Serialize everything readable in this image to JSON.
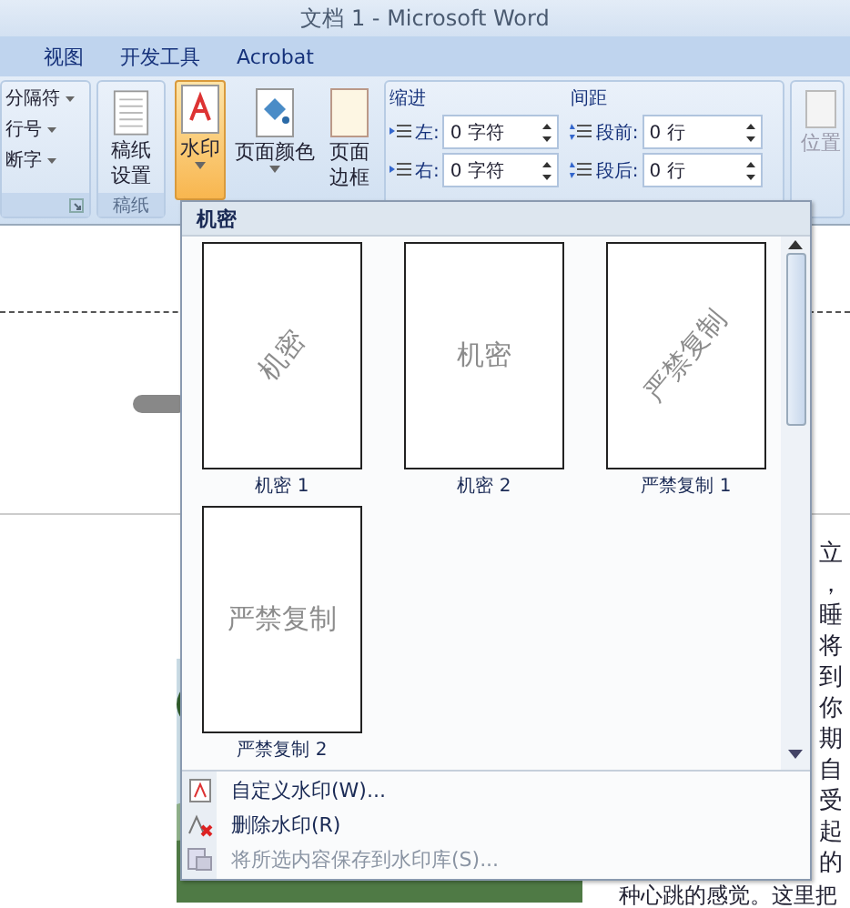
{
  "window": {
    "title": "文档 1 - Microsoft Word"
  },
  "tabs": [
    {
      "label": "视图",
      "selected": false
    },
    {
      "label": "开发工具",
      "selected": false
    },
    {
      "label": "Acrobat",
      "selected": false
    }
  ],
  "ribbon": {
    "breaks_group": {
      "items": [
        "分隔符",
        "行号",
        "断字"
      ]
    },
    "paper_group": {
      "button": [
        "稿纸",
        "设置"
      ],
      "label": "稿纸"
    },
    "background_group": {
      "buttons": [
        {
          "label": [
            "水印"
          ],
          "selected": true,
          "dropdown": true
        },
        {
          "label": [
            "页面颜色"
          ],
          "selected": false,
          "dropdown": true
        },
        {
          "label": [
            "页面",
            "边框"
          ],
          "selected": false,
          "dropdown": false
        }
      ]
    },
    "indent": {
      "title": "缩进",
      "fields": [
        {
          "label": "左:",
          "value": "0 字符"
        },
        {
          "label": "右:",
          "value": "0 字符"
        }
      ]
    },
    "spacing": {
      "title": "间距",
      "fields": [
        {
          "label": "段前:",
          "value": "0 行"
        },
        {
          "label": "段后:",
          "value": "0 行"
        }
      ]
    },
    "position": {
      "label": "位置",
      "disabled": true
    }
  },
  "document": {
    "right_column": [
      "立",
      "，",
      "睡",
      "将",
      "到",
      "你",
      "期",
      "自",
      "受",
      "起",
      "的"
    ],
    "bottom_line": "种心跳的感觉。这里把"
  },
  "watermark_menu": {
    "section": "机密",
    "gallery": [
      {
        "label": "机密 1",
        "text": "机密",
        "kind": "diagonal"
      },
      {
        "label": "机密 2",
        "text": "机密",
        "kind": "horizontal"
      },
      {
        "label": "严禁复制 1",
        "text": "严禁复制",
        "kind": "diagonal"
      },
      {
        "label": "严禁复制 2",
        "text": "严禁复制",
        "kind": "horizontal"
      }
    ],
    "commands": [
      {
        "label": "自定义水印(W)...",
        "disabled": false
      },
      {
        "label": "删除水印(R)",
        "disabled": false
      },
      {
        "label": "将所选内容保存到水印库(S)...",
        "disabled": true
      }
    ]
  }
}
